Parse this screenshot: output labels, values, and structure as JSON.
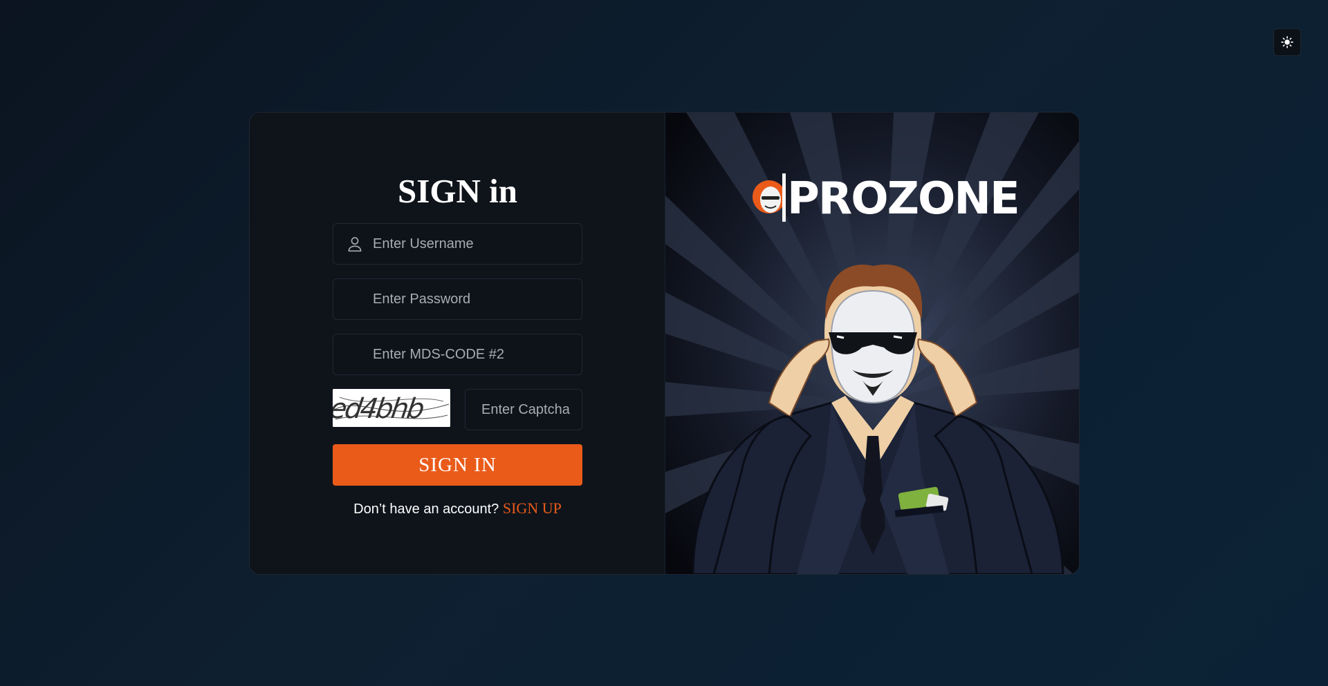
{
  "theme_toggle": {
    "icon": "sun-icon"
  },
  "form": {
    "title": "SIGN in",
    "username_placeholder": "Enter Username",
    "password_placeholder": "Enter Password",
    "mds_placeholder": "Enter MDS-CODE #2",
    "captcha_text": "ed4bhb",
    "captcha_placeholder": "Enter Captcha",
    "signin_label": "SIGN IN",
    "signup_prompt": "Don’t have an account?",
    "signup_label": "SIGN UP"
  },
  "brand": {
    "logo_text": "PROZONE",
    "accent_color": "#ea5b1a"
  }
}
